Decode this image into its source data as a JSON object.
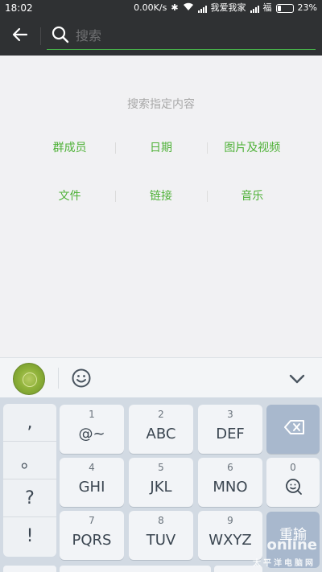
{
  "status_bar": {
    "time": "18:02",
    "speed": "0.00K/s",
    "network_label": "我爱我家",
    "carrier": "福",
    "battery": "23%",
    "battery_level": 0.23
  },
  "search": {
    "placeholder": "搜索",
    "value": "",
    "accent_color": "#47b04a"
  },
  "main": {
    "hint": "搜索指定内容",
    "categories_row1": [
      "群成员",
      "日期",
      "图片及视频"
    ],
    "categories_row2": [
      "文件",
      "链接",
      "音乐"
    ],
    "category_color": "#4eb137"
  },
  "keyboard": {
    "side_keys": [
      ",",
      "。",
      "?",
      "!"
    ],
    "keys": [
      {
        "num": "1",
        "label": "@~"
      },
      {
        "num": "2",
        "label": "ABC"
      },
      {
        "num": "3",
        "label": "DEF"
      },
      {
        "num": "4",
        "label": "GHI"
      },
      {
        "num": "5",
        "label": "JKL"
      },
      {
        "num": "6",
        "label": "MNO"
      },
      {
        "num": "7",
        "label": "PQRS"
      },
      {
        "num": "8",
        "label": "TUV"
      },
      {
        "num": "9",
        "label": "WXYZ"
      }
    ],
    "zero_key_num": "0",
    "enter_label": "重输"
  },
  "watermark": {
    "main": "online",
    "sub": "太平洋电脑网"
  },
  "icons": {
    "back": "arrow-left-icon",
    "search": "search-icon",
    "emoji": "smiley-icon",
    "collapse": "chevron-down-icon",
    "delete": "backspace-icon"
  }
}
